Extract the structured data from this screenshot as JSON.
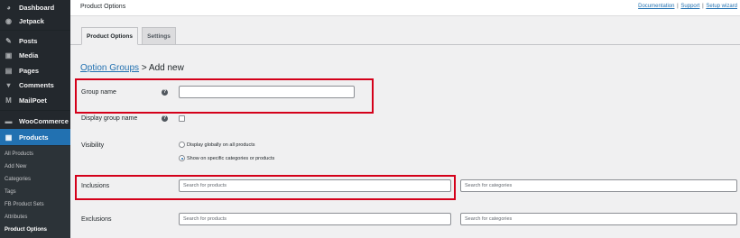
{
  "sidebar": {
    "items": [
      {
        "label": "Dashboard",
        "icon": "dashboard-icon",
        "glyph": "◕"
      },
      {
        "label": "Jetpack",
        "icon": "jetpack-icon",
        "glyph": "◉"
      },
      {
        "label": "Posts",
        "icon": "pin-icon",
        "glyph": "✎"
      },
      {
        "label": "Media",
        "icon": "media-icon",
        "glyph": "▣"
      },
      {
        "label": "Pages",
        "icon": "page-icon",
        "glyph": "▤"
      },
      {
        "label": "Comments",
        "icon": "comment-icon",
        "glyph": "▾"
      },
      {
        "label": "MailPoet",
        "icon": "mailpoet-icon",
        "glyph": "M"
      },
      {
        "label": "WooCommerce",
        "icon": "woocommerce-icon",
        "glyph": "▬"
      },
      {
        "label": "Products",
        "icon": "products-icon",
        "glyph": "▦"
      }
    ],
    "submenu": [
      "All Products",
      "Add New",
      "Categories",
      "Tags",
      "FB Product Sets",
      "Attributes",
      "Product Options"
    ]
  },
  "topbar": {
    "title": "Product Options",
    "links": {
      "documentation": "Documentation",
      "support": "Support",
      "setup": "Setup wizard"
    },
    "separator": "|"
  },
  "tabs": {
    "product_options": "Product Options",
    "settings": "Settings"
  },
  "heading": {
    "link": "Option Groups",
    "rest": "> Add new"
  },
  "form": {
    "group_name_label": "Group name",
    "display_group_name_label": "Display group name",
    "visibility_label": "Visibility",
    "visibility_options": [
      "Display globally on all products",
      "Show on specific categories or products"
    ],
    "inclusions_label": "Inclusions",
    "exclusions_label": "Exclusions",
    "products_placeholder": "Search for products",
    "categories_placeholder": "Search for categories",
    "help_glyph": "?"
  },
  "colors": {
    "accent": "#2271b1",
    "highlight": "#d4001a",
    "sidebar_bg": "#23282d"
  }
}
